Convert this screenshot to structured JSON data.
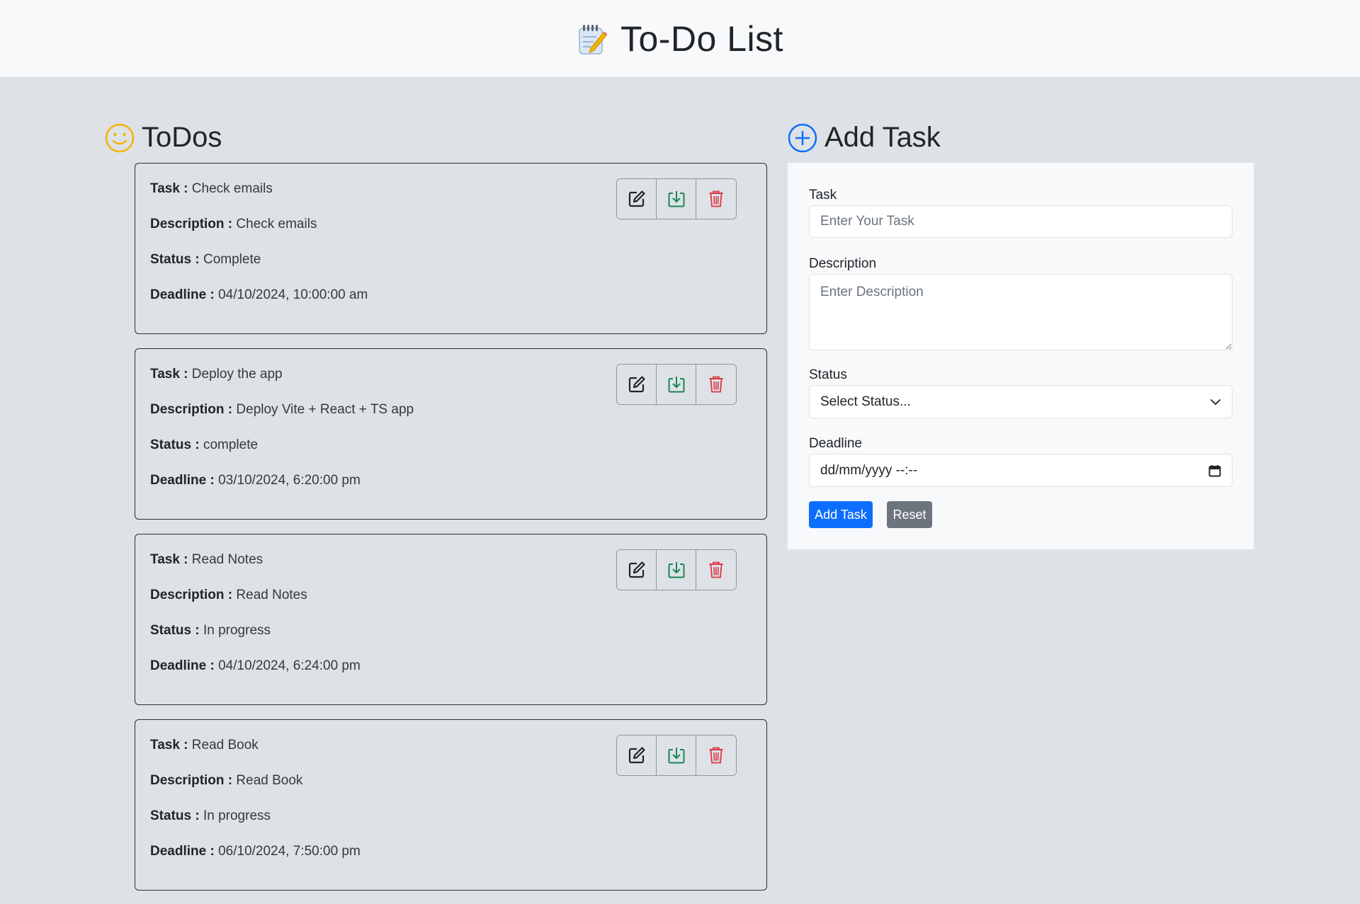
{
  "header": {
    "title": "To-Do List",
    "icon": "memo-icon"
  },
  "todos_section": {
    "heading": "ToDos",
    "icon": "smiley-icon",
    "icon_color": "#f5b301"
  },
  "labels": {
    "task": "Task :",
    "description": "Description :",
    "status": "Status :",
    "deadline": "Deadline :"
  },
  "todos": [
    {
      "task": "Check emails",
      "description": "Check emails",
      "status": "Complete",
      "deadline": "04/10/2024, 10:00:00 am"
    },
    {
      "task": "Deploy the app",
      "description": "Deploy Vite + React + TS app",
      "status": "complete",
      "deadline": "03/10/2024, 6:20:00 pm"
    },
    {
      "task": "Read Notes",
      "description": "Read Notes",
      "status": "In progress",
      "deadline": "04/10/2024, 6:24:00 pm"
    },
    {
      "task": "Read Book",
      "description": "Read Book",
      "status": "In progress",
      "deadline": "06/10/2024, 7:50:00 pm"
    }
  ],
  "card_actions": [
    {
      "name": "edit",
      "icon": "edit-icon",
      "color": "#212529"
    },
    {
      "name": "save",
      "icon": "download-icon",
      "color": "#198754"
    },
    {
      "name": "delete",
      "icon": "trash-icon",
      "color": "#dc3545"
    }
  ],
  "add_section": {
    "heading": "Add Task",
    "icon": "plus-circle-icon",
    "icon_color": "#0d6efd"
  },
  "form": {
    "task_label": "Task",
    "task_placeholder": "Enter Your Task",
    "description_label": "Description",
    "description_placeholder": "Enter Description",
    "status_label": "Status",
    "status_value": "Select Status...",
    "deadline_label": "Deadline",
    "deadline_value": "dd/mm/yyyy --:--",
    "submit_label": "Add Task",
    "reset_label": "Reset"
  },
  "colors": {
    "primary": "#0d6efd",
    "secondary": "#6c757d",
    "background": "#dee2e6",
    "panel": "#f8f9fa"
  }
}
